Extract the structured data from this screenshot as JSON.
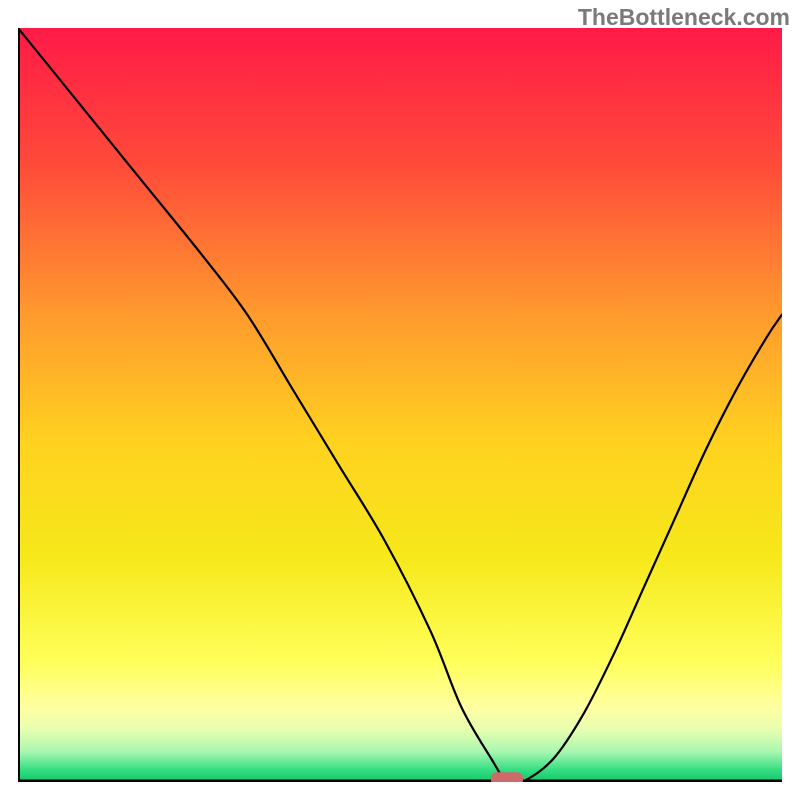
{
  "watermark": "TheBottleneck.com",
  "chart_data": {
    "type": "line",
    "title": "",
    "xlabel": "",
    "ylabel": "",
    "xlim": [
      0,
      100
    ],
    "ylim": [
      0,
      100
    ],
    "gradient_stops": [
      {
        "offset": 0.0,
        "color": "#ff1a47"
      },
      {
        "offset": 0.18,
        "color": "#ff4a3a"
      },
      {
        "offset": 0.38,
        "color": "#ff9a2e"
      },
      {
        "offset": 0.55,
        "color": "#ffd21f"
      },
      {
        "offset": 0.7,
        "color": "#f6e81a"
      },
      {
        "offset": 0.84,
        "color": "#ffff5a"
      },
      {
        "offset": 0.9,
        "color": "#ffffa0"
      },
      {
        "offset": 0.93,
        "color": "#e8ffb0"
      },
      {
        "offset": 0.96,
        "color": "#a8f7b0"
      },
      {
        "offset": 0.985,
        "color": "#30dd80"
      },
      {
        "offset": 1.0,
        "color": "#16c66a"
      }
    ],
    "series": [
      {
        "name": "bottleneck-curve",
        "x": [
          0,
          8,
          16,
          24,
          30,
          36,
          42,
          48,
          54,
          58,
          62,
          64,
          66,
          70,
          74,
          78,
          82,
          86,
          90,
          94,
          98,
          100
        ],
        "y": [
          100,
          90,
          80,
          70,
          62,
          52,
          42,
          32,
          20,
          10,
          3,
          0,
          0,
          3,
          9,
          17,
          26,
          35,
          44,
          52,
          59,
          62
        ]
      }
    ],
    "marker": {
      "name": "optimal-badge",
      "x": 64,
      "y": 0,
      "width": 4.2,
      "height": 1.8,
      "color": "#cf6a6a"
    }
  }
}
